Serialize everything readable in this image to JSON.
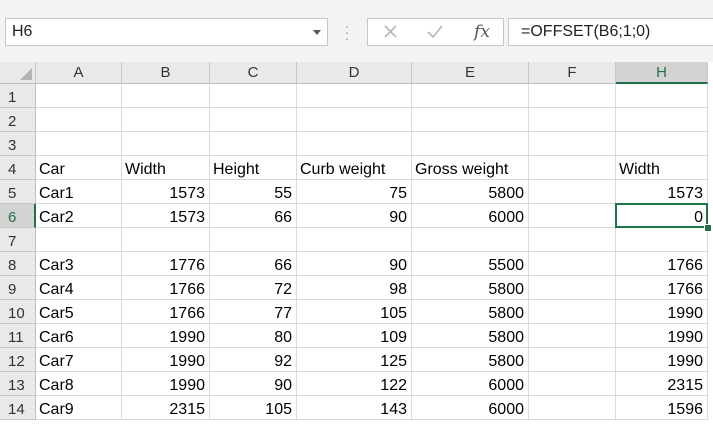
{
  "name_box": {
    "value": "H6"
  },
  "formula_bar": {
    "cancel_icon": "close-icon",
    "enter_icon": "check-icon",
    "function_label": "fx",
    "formula": "=OFFSET(B6;1;0)"
  },
  "columns": [
    "A",
    "B",
    "C",
    "D",
    "E",
    "F",
    "H"
  ],
  "rows": [
    "1",
    "2",
    "3",
    "4",
    "5",
    "6",
    "7",
    "8",
    "9",
    "10",
    "11",
    "12",
    "13",
    "14"
  ],
  "selected": {
    "column": "H",
    "row": "6"
  },
  "cells": {
    "r4": {
      "A": "Car",
      "B": "Width",
      "C": "Height",
      "D": "Curb weight",
      "E": "Gross weight",
      "H": "Width"
    },
    "r5": {
      "A": "Car1",
      "B": "1573",
      "C": "55",
      "D": "75",
      "E": "5800",
      "H": "1573"
    },
    "r6": {
      "A": "Car2",
      "B": "1573",
      "C": "66",
      "D": "90",
      "E": "6000",
      "H": "0"
    },
    "r8": {
      "A": "Car3",
      "B": "1776",
      "C": "66",
      "D": "90",
      "E": "5500",
      "H": "1766"
    },
    "r9": {
      "A": "Car4",
      "B": "1766",
      "C": "72",
      "D": "98",
      "E": "5800",
      "H": "1766"
    },
    "r10": {
      "A": "Car5",
      "B": "1766",
      "C": "77",
      "D": "105",
      "E": "5800",
      "H": "1990"
    },
    "r11": {
      "A": "Car6",
      "B": "1990",
      "C": "80",
      "D": "109",
      "E": "5800",
      "H": "1990"
    },
    "r12": {
      "A": "Car7",
      "B": "1990",
      "C": "92",
      "D": "125",
      "E": "5800",
      "H": "1990"
    },
    "r13": {
      "A": "Car8",
      "B": "1990",
      "C": "90",
      "D": "122",
      "E": "6000",
      "H": "2315"
    },
    "r14": {
      "A": "Car9",
      "B": "2315",
      "C": "105",
      "D": "143",
      "E": "6000",
      "H": "1596"
    }
  },
  "colors": {
    "accent": "#217346",
    "gridline": "#dadada",
    "header_bg": "#e9e9e9"
  }
}
